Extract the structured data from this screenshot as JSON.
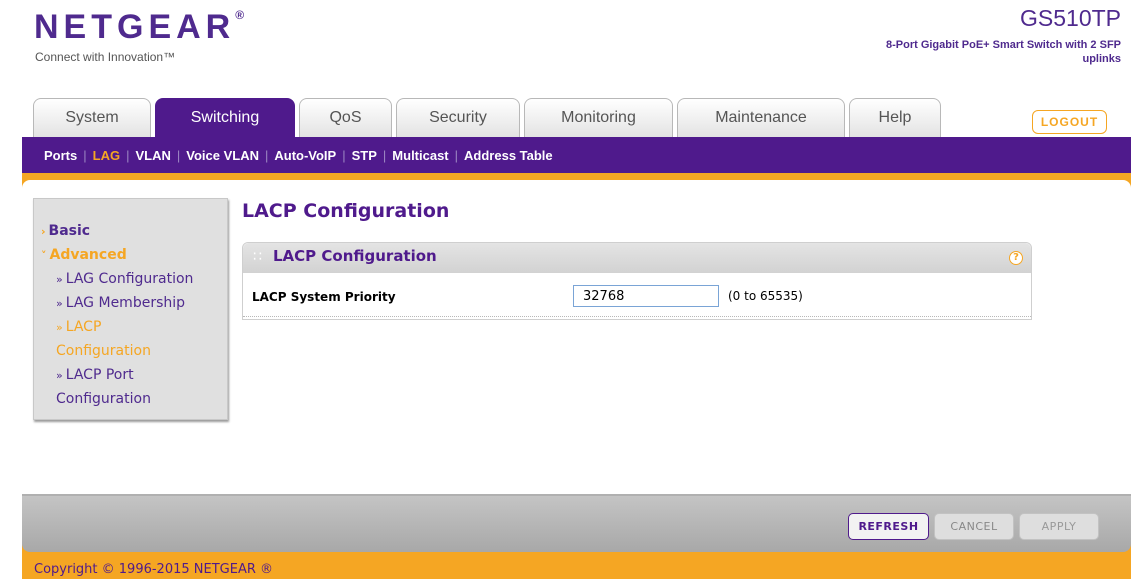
{
  "brand": {
    "logo": "NETGEAR",
    "logo_mark": "®",
    "tagline": "Connect with Innovation™",
    "model": "GS510TP",
    "model_desc": "8-Port Gigabit PoE+ Smart Switch with 2 SFP uplinks"
  },
  "tabs": [
    {
      "label": "System"
    },
    {
      "label": "Switching"
    },
    {
      "label": "QoS"
    },
    {
      "label": "Security"
    },
    {
      "label": "Monitoring"
    },
    {
      "label": "Maintenance"
    },
    {
      "label": "Help"
    }
  ],
  "active_tab": "Switching",
  "logout_label": "LOGOUT",
  "subnav": [
    {
      "label": "Ports"
    },
    {
      "label": "LAG"
    },
    {
      "label": "VLAN"
    },
    {
      "label": "Voice VLAN"
    },
    {
      "label": "Auto-VoIP"
    },
    {
      "label": "STP"
    },
    {
      "label": "Multicast"
    },
    {
      "label": "Address Table"
    }
  ],
  "sidebar": {
    "basic": "Basic",
    "advanced": "Advanced",
    "items": [
      {
        "label": "LAG Configuration"
      },
      {
        "label": "LAG Membership"
      },
      {
        "label": "LACP"
      },
      {
        "label": "Configuration"
      },
      {
        "label": "LACP Port"
      },
      {
        "label": "Configuration"
      }
    ]
  },
  "page_title": "LACP Configuration",
  "box": {
    "title": "LACP Configuration",
    "help": "?",
    "field_label": "LACP System Priority",
    "field_value": "32768",
    "field_range": "(0 to 65535)"
  },
  "buttons": {
    "refresh": "REFRESH",
    "cancel": "CANCEL",
    "apply": "APPLY"
  },
  "copyright": "Copyright © 1996-2015 NETGEAR ®",
  "colors": {
    "brand_purple": "#4f1a8c",
    "accent_orange": "#f5a623"
  }
}
